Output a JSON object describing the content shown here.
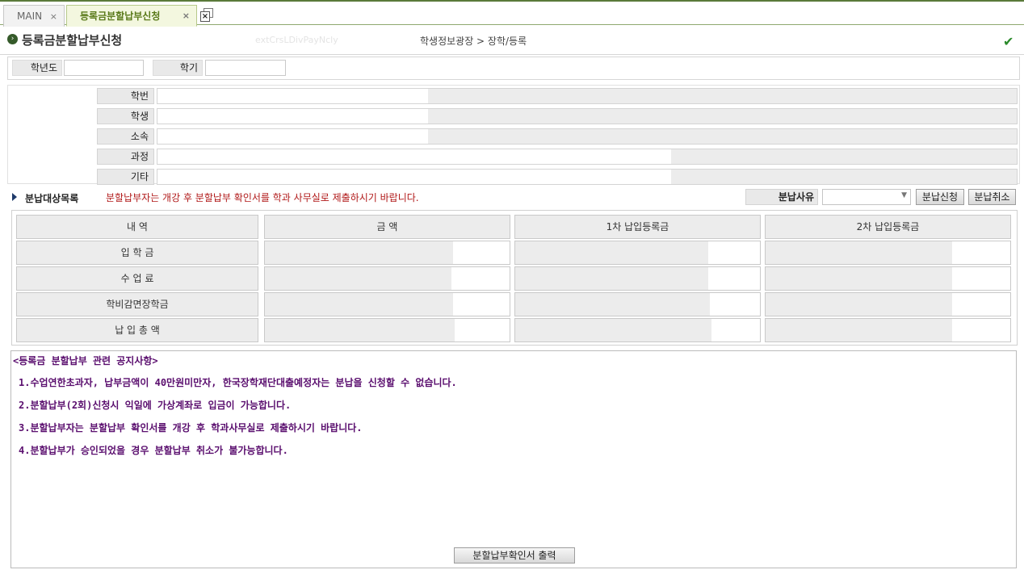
{
  "tabs": [
    {
      "label": "MAIN",
      "close": "×"
    },
    {
      "label": "등록금분할납부신청",
      "close": "×"
    }
  ],
  "header": {
    "title": "등록금분할납부신청",
    "faint_text": "extCrsLDivPayNcly",
    "breadcrumb": "학생정보광장 > 장학/등록"
  },
  "search": {
    "year_label": "학년도",
    "term_label": "학기"
  },
  "student": {
    "fields": [
      {
        "label": "학번"
      },
      {
        "label": "학생"
      },
      {
        "label": "소속"
      },
      {
        "label": "과정"
      },
      {
        "label": "기타"
      }
    ]
  },
  "section": {
    "title": "분납대상목록",
    "notice": "분할납부자는 개강 후 분할납부 확인서를 학과 사무실로 제출하시기 바랍니다.",
    "reason_label": "분납사유",
    "reason_value": "",
    "apply_button": "분납신청",
    "cancel_button": "분납취소"
  },
  "table": {
    "headers": [
      "내          역",
      "금    액",
      "1차 납입등록금",
      "2차 납입등록금"
    ],
    "rows": [
      {
        "label": "입    학    금",
        "amount": "",
        "first": "",
        "second": ""
      },
      {
        "label": "수    업    료",
        "amount": "",
        "first": "",
        "second": ""
      },
      {
        "label": "학비감면장학금",
        "amount": "",
        "first": "",
        "second": ""
      },
      {
        "label": "납  입  총  액",
        "amount": "",
        "first": "",
        "second": ""
      }
    ]
  },
  "notice": {
    "title": "<등록금 분할납부 관련 공지사항>",
    "lines": [
      "1.수업연한초과자, 납부금액이 40만원미만자, 한국장학재단대출예정자는 분납을 신청할 수 없습니다.",
      "2.분할납부(2회)신청시 익일에 가상계좌로 입금이 가능합니다.",
      "3.분할납부자는 분할납부 확인서를 개강 후 학과사무실로 제출하시기 바랍니다.",
      "4.분할납부가 승인되었을 경우 분할납부 취소가 불가능합니다."
    ],
    "print_button": "분할납부확인서 출력"
  },
  "colors": {
    "accent_green": "#5a7a1a",
    "notice_red": "#b01818",
    "notice_purple": "#5a0e6e"
  },
  "icons": [
    "circle-arrow-icon",
    "check-icon",
    "close-all-tabs-icon",
    "triangle-bullet-icon",
    "chevron-down-icon"
  ]
}
